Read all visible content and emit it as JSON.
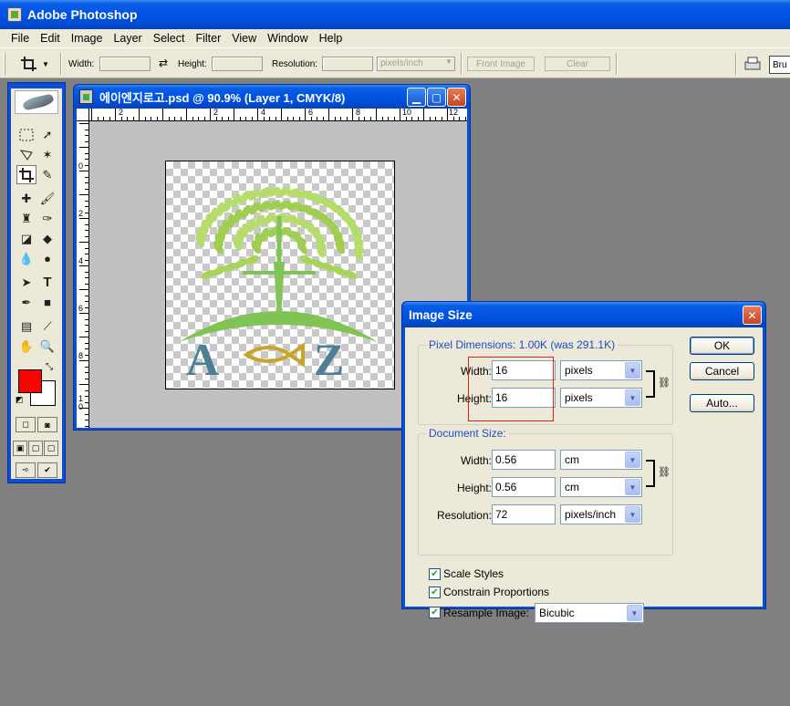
{
  "app": {
    "title": "Adobe Photoshop"
  },
  "menu": [
    "File",
    "Edit",
    "Image",
    "Layer",
    "Select",
    "Filter",
    "View",
    "Window",
    "Help"
  ],
  "options_bar": {
    "width_label": "Width:",
    "height_label": "Height:",
    "resolution_label": "Resolution:",
    "unit_value": "pixels/inch",
    "front_image_label": "Front Image",
    "clear_label": "Clear",
    "brushes_label": "Bru"
  },
  "document": {
    "title": "에이엔지로고.psd @ 90.9% (Layer 1, CMYK/8)",
    "ruler_h": [
      "2",
      "2",
      "4",
      "6",
      "8",
      "10",
      "12"
    ],
    "ruler_v": [
      "0",
      "2",
      "4",
      "6",
      "8",
      "1\n0"
    ],
    "logo_left_letter": "A",
    "logo_right_letter": "Z"
  },
  "dialog": {
    "title": "Image Size",
    "pixel_dimensions_legend": "Pixel Dimensions:  1.00K (was 291.1K)",
    "pd_width_label": "Width:",
    "pd_width_value": "16",
    "pd_width_unit": "pixels",
    "pd_height_label": "Height:",
    "pd_height_value": "16",
    "pd_height_unit": "pixels",
    "document_size_legend": "Document Size:",
    "ds_width_label": "Width:",
    "ds_width_value": "0.56",
    "ds_width_unit": "cm",
    "ds_height_label": "Height:",
    "ds_height_value": "0.56",
    "ds_height_unit": "cm",
    "resolution_label": "Resolution:",
    "resolution_value": "72",
    "resolution_unit": "pixels/inch",
    "scale_styles_label": "Scale Styles",
    "constrain_label": "Constrain Proportions",
    "resample_label": "Resample Image:",
    "resample_value": "Bicubic",
    "ok_label": "OK",
    "cancel_label": "Cancel",
    "auto_label": "Auto..."
  },
  "colors": {
    "foreground": "#ff0000",
    "background": "#ffffff",
    "leaf_green": "#a8d45a",
    "trunk_green": "#7fc454",
    "letter_blue": "#4d7f96",
    "fish_gold": "#c8a52a"
  }
}
